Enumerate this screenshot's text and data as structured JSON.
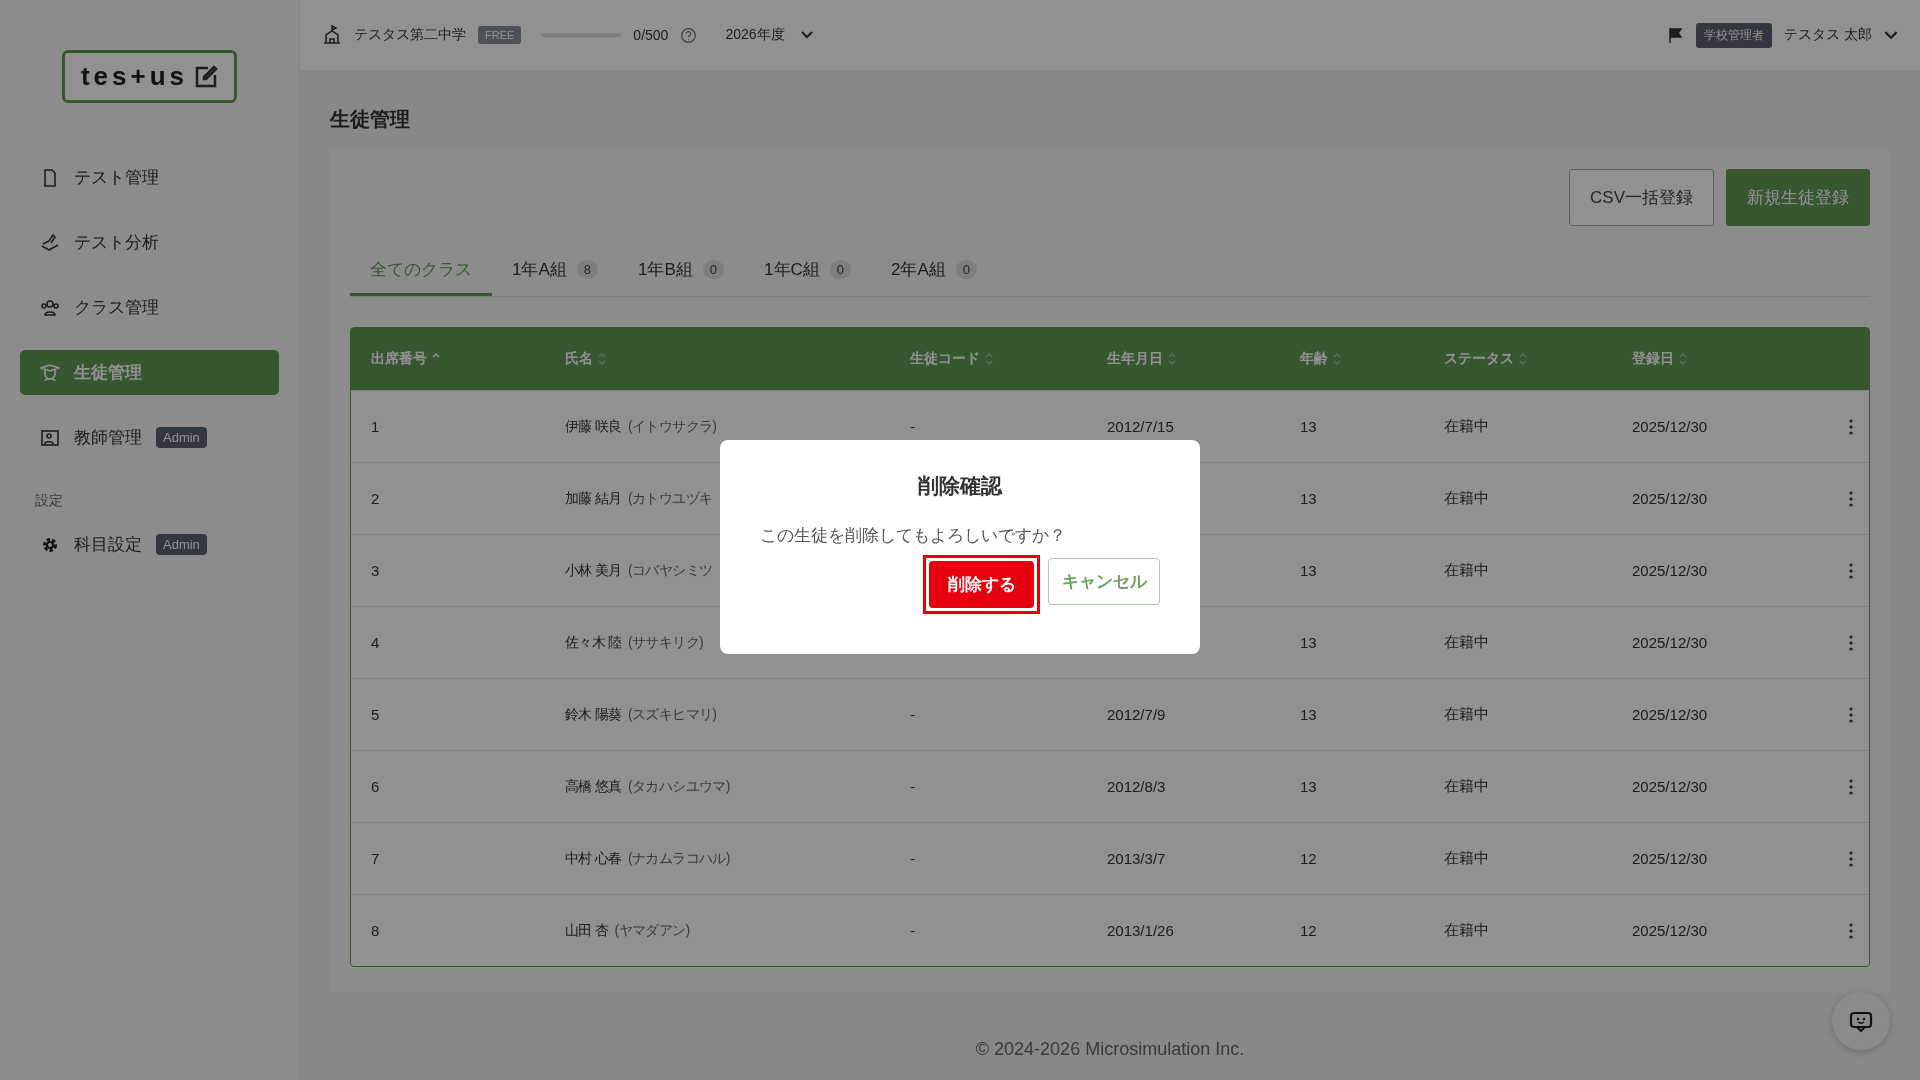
{
  "header": {
    "school": "テスタス第二中学",
    "plan": "FREE",
    "usage": {
      "level": 0,
      "reading": "0/500"
    },
    "year": "2026年度",
    "role": "学校管理者",
    "user": "テスタス 太郎"
  },
  "sidebar": {
    "logo": "tes+us",
    "items": [
      {
        "label": "テスト管理",
        "kind": "document",
        "selected": false
      },
      {
        "label": "テスト分析",
        "kind": "pen",
        "selected": false
      },
      {
        "label": "クラス管理",
        "kind": "people",
        "selected": false
      },
      {
        "label": "生徒管理",
        "kind": "student",
        "selected": true
      },
      {
        "label": "教師管理",
        "kind": "teacher",
        "selected": false,
        "badge": "Admin"
      }
    ],
    "section": "設定",
    "settings": [
      {
        "label": "科目設定",
        "kind": "gear",
        "selected": false,
        "badge": "Admin"
      }
    ]
  },
  "page": {
    "title": "生徒管理",
    "buttons": [
      {
        "label": "CSV一括登録",
        "kind": "outline"
      },
      {
        "label": "新規生徒登録",
        "kind": "primary"
      }
    ],
    "tabs": [
      {
        "label": "全てのクラス",
        "selected": true
      },
      {
        "label": "1年A組",
        "count": "8",
        "selected": false
      },
      {
        "label": "1年B組",
        "count": "0",
        "selected": false
      },
      {
        "label": "1年C組",
        "count": "0",
        "selected": false
      },
      {
        "label": "2年A組",
        "count": "0",
        "selected": false
      }
    ]
  },
  "table": {
    "columns": [
      {
        "label": "出席番号",
        "sorted": true
      },
      {
        "label": "氏名",
        "sorted": false
      },
      {
        "label": "生徒コード",
        "sorted": false
      },
      {
        "label": "生年月日",
        "sorted": false
      },
      {
        "label": "年齢",
        "sorted": false
      },
      {
        "label": "ステータス",
        "sorted": false
      },
      {
        "label": "登録日",
        "sorted": false
      }
    ],
    "rows": [
      {
        "no": "1",
        "name": "伊藤 咲良",
        "reading": "(イトウサクラ)",
        "code": "-",
        "birth": "2012/7/15",
        "age": "13",
        "status": "在籍中",
        "registered": "2025/12/30"
      },
      {
        "no": "2",
        "name": "加藤 結月",
        "reading": "(カトウユヅキ",
        "age": "13",
        "status": "在籍中",
        "registered": "2025/12/30"
      },
      {
        "no": "3",
        "name": "小林 美月",
        "reading": "(コバヤシミツ",
        "age": "13",
        "status": "在籍中",
        "registered": "2025/12/30"
      },
      {
        "no": "4",
        "name": "佐々木 陸",
        "reading": "(ササキリク)",
        "age": "13",
        "status": "在籍中",
        "registered": "2025/12/30"
      },
      {
        "no": "5",
        "name": "鈴木 陽葵",
        "reading": "(スズキヒマリ)",
        "code": "-",
        "birth": "2012/7/9",
        "age": "13",
        "status": "在籍中",
        "registered": "2025/12/30"
      },
      {
        "no": "6",
        "name": "高橋 悠真",
        "reading": "(タカハシユウマ)",
        "code": "-",
        "birth": "2012/8/3",
        "age": "13",
        "status": "在籍中",
        "registered": "2025/12/30"
      },
      {
        "no": "7",
        "name": "中村 心春",
        "reading": "(ナカムラコハル)",
        "code": "-",
        "birth": "2013/3/7",
        "age": "12",
        "status": "在籍中",
        "registered": "2025/12/30"
      },
      {
        "no": "8",
        "name": "山田 杏",
        "reading": "(ヤマダアン)",
        "code": "-",
        "birth": "2013/1/26",
        "age": "12",
        "status": "在籍中",
        "registered": "2025/12/30"
      }
    ]
  },
  "footer": "© 2024-2026 Microsimulation Inc.",
  "dialog": {
    "title": "削除確認",
    "message": "この生徒を削除してもよろしいですか？",
    "confirm": {
      "label": "削除する",
      "highlighted": true
    },
    "cancel": "キャンセル"
  }
}
